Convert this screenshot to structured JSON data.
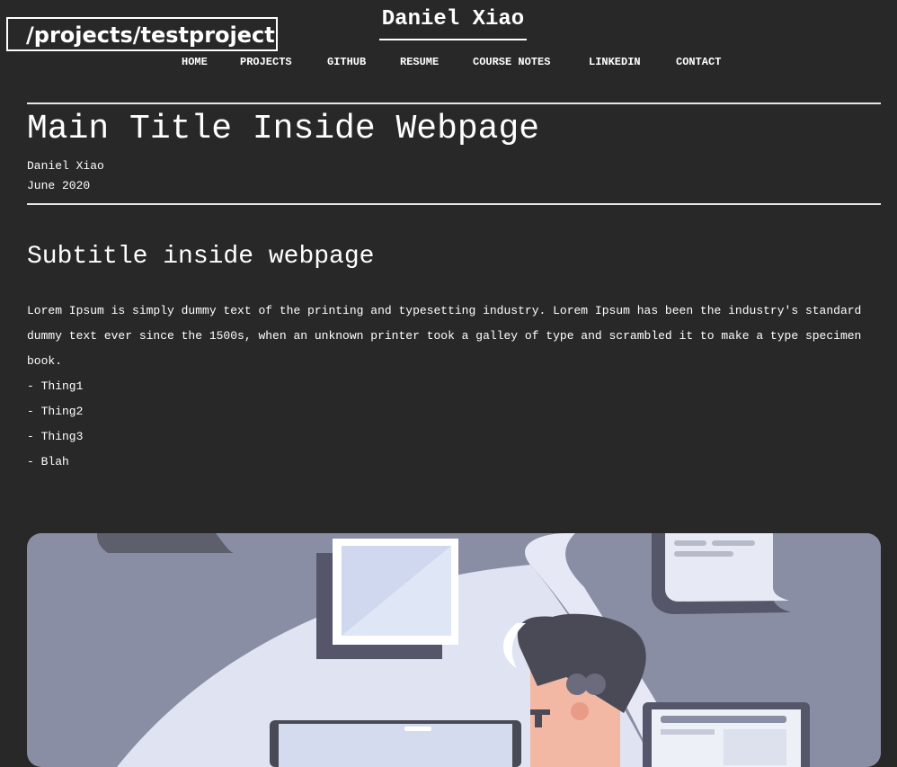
{
  "path_label": "/projects/testproject",
  "site": {
    "title": "Daniel Xiao"
  },
  "nav": [
    "HOME",
    "PROJECTS",
    "GITHUB",
    "RESUME",
    "COURSE NOTES",
    "LINKEDIN",
    "CONTACT"
  ],
  "article": {
    "title": "Main Title Inside Webpage",
    "author": "Daniel Xiao",
    "date": "June 2020",
    "subtitle": "Subtitle inside webpage",
    "paragraph": "Lorem Ipsum is simply dummy text of the printing and typesetting industry. Lorem Ipsum has been the industry's standard dummy text ever since the 1500s, when an unknown printer took a galley of type and scrambled it to make a type specimen book.",
    "list": [
      "- Thing1",
      "- Thing2",
      "- Thing3",
      "- Blah"
    ]
  },
  "colors": {
    "background": "#282828",
    "text": "#ffffff",
    "illustration_bg": "#8a8ea4"
  },
  "icons": {
    "illustration": "person-at-computer-illustration"
  }
}
